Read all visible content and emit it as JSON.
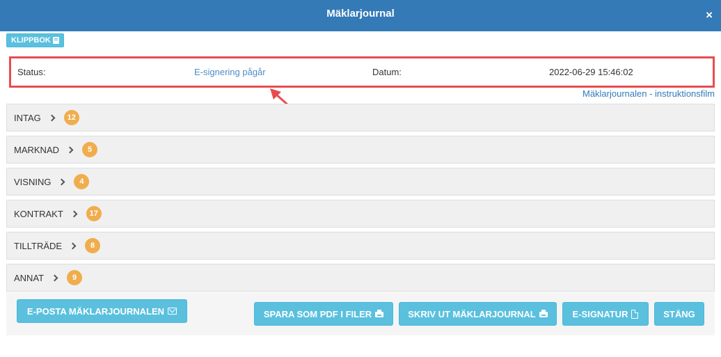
{
  "header": {
    "title": "Mäklarjournal",
    "close_glyph": "×"
  },
  "clipboard": {
    "label": "KLIPPBOK",
    "icon": "book-icon"
  },
  "status": {
    "status_label": "Status:",
    "status_value": "E-signering pågår",
    "date_label": "Datum:",
    "date_value": "2022-06-29 15:46:02"
  },
  "instruction_link": "Mäklarjournalen - instruktionsfilm",
  "sections": [
    {
      "name": "INTAG",
      "count": "12"
    },
    {
      "name": "MARKNAD",
      "count": "5"
    },
    {
      "name": "VISNING",
      "count": "4"
    },
    {
      "name": "KONTRAKT",
      "count": "17"
    },
    {
      "name": "TILLTRÄDE",
      "count": "8"
    },
    {
      "name": "ANNAT",
      "count": "9"
    }
  ],
  "buttons": {
    "email": "E-POSTA MÄKLARJOURNALEN",
    "save_pdf": "SPARA SOM PDF I FILER",
    "print": "SKRIV UT MÄKLARJOURNAL",
    "esign": "E-SIGNATUR",
    "close": "STÄNG"
  },
  "colors": {
    "header": "#337ab7",
    "button": "#5bc0de",
    "badge": "#f0ad4e",
    "highlight": "#e84c4f"
  }
}
